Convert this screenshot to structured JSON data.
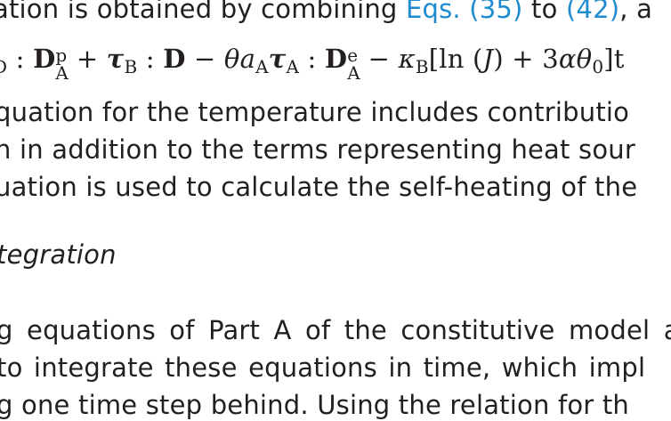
{
  "paragraph_intro": {
    "text_before": "ation is obtained by combining ",
    "link1": "Eqs. (35)",
    "text_mid": " to ",
    "link2": "(42)",
    "text_after": ", a"
  },
  "equation": {
    "gamma_sub": "D",
    "colon1": " : ",
    "D1": "D",
    "D1_sup": "p",
    "D1_sub": "A",
    "plus": " + ",
    "tau_b": "τ",
    "tau_b_sub": "B",
    "colon2": " : ",
    "D2": "D",
    "minus1": " − ",
    "theta_a": "θa",
    "a_sub": "A",
    "tau_a": "τ",
    "tau_a_sub": "A",
    "colon3": " : ",
    "D3": "D",
    "D3_sup": "e",
    "D3_sub": "A",
    "minus2": " − ",
    "kappa": "κ",
    "kappa_sub": "B",
    "bracket": "[ln (",
    "J": "J",
    "bracket_close": ") + 3",
    "alpha_theta": "αθ",
    "theta_sub": "0",
    "tail": "]t"
  },
  "paragraph_body": {
    "line1": "quation for the temperature includes contributio",
    "line2": "n in addition to the terms representing heat sour",
    "line3": "uation is used to calculate the self-heating of the"
  },
  "section_heading": "tegration",
  "paragraph_next": {
    "line1": "g equations of Part A of the constitutive model a",
    "line2": " to integrate these equations in time, which impl",
    "line3": "g one time step behind. Using the relation for th"
  }
}
